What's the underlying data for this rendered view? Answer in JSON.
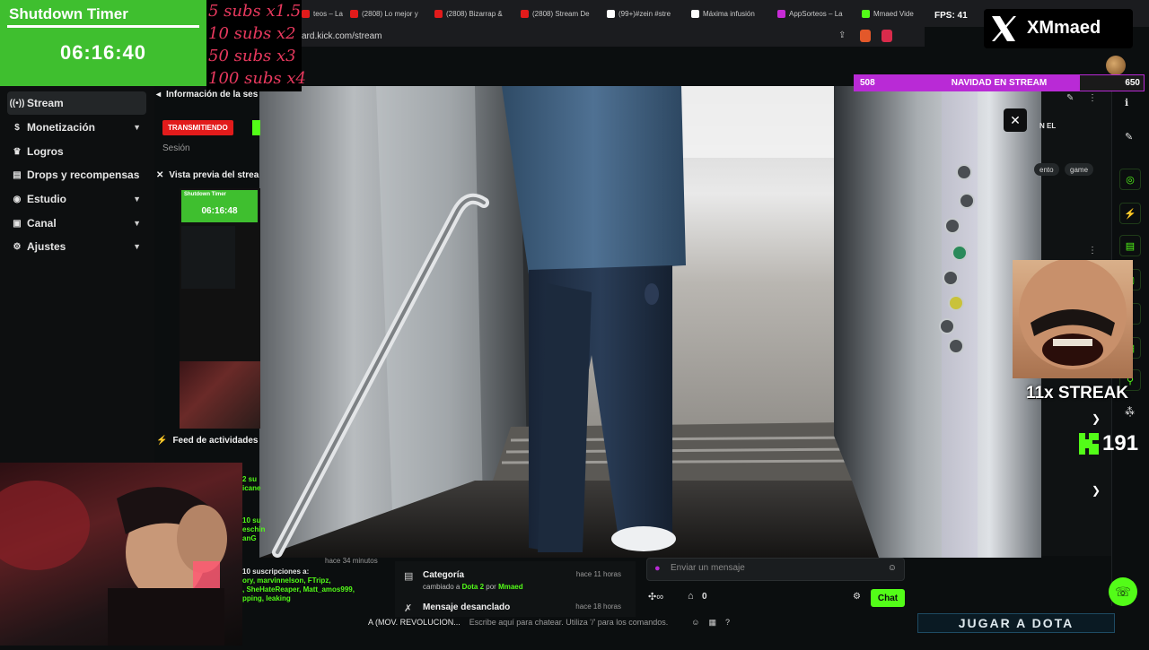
{
  "browser": {
    "tabs": [
      {
        "label": "teos – La",
        "color": "#e21b1b"
      },
      {
        "label": "(2808) Lo mejor y",
        "color": "#e21b1b"
      },
      {
        "label": "(2808) Bizarrap &",
        "color": "#e21b1b"
      },
      {
        "label": "(2808) Stream De",
        "color": "#e21b1b"
      },
      {
        "label": "(99+)#zein #stre",
        "color": "#ffffff"
      },
      {
        "label": "Máxima infusión",
        "color": "#ffffff"
      },
      {
        "label": "AppSorteos – La",
        "color": "#c72bd6"
      },
      {
        "label": "Mmaed Vide",
        "color": "#53fc18"
      }
    ],
    "url": "ard.kick.com/stream",
    "fps_label": "FPS: 41"
  },
  "timer": {
    "title": "Shutdown Timer",
    "value": "06:16:40"
  },
  "subs": [
    "5 subs x1.5",
    "10 subs x2",
    "50 subs x3",
    "100 subs x4"
  ],
  "sidebar": {
    "items": [
      {
        "label": "Stream",
        "icon": "broadcast-icon",
        "glyph": "((•))",
        "chevron": false,
        "active": true
      },
      {
        "label": "Monetización",
        "icon": "dollar-icon",
        "glyph": "$",
        "chevron": true,
        "active": false
      },
      {
        "label": "Logros",
        "icon": "trophy-icon",
        "glyph": "🏆",
        "chevron": false,
        "active": false
      },
      {
        "label": "Drops y recompensas",
        "icon": "gift-icon",
        "glyph": "🎁",
        "chevron": false,
        "active": false
      },
      {
        "label": "Estudio",
        "icon": "studio-icon",
        "glyph": "◉",
        "chevron": true,
        "active": false
      },
      {
        "label": "Canal",
        "icon": "channel-icon",
        "glyph": "▣",
        "chevron": true,
        "active": false
      },
      {
        "label": "Ajustes",
        "icon": "gear-icon",
        "glyph": "⚙",
        "chevron": true,
        "active": false
      }
    ]
  },
  "session": {
    "heading": "Información de la ses",
    "badge": "TRANSMITIENDO",
    "label": "Sesión"
  },
  "preview": {
    "heading": "Vista previa del strea",
    "timer_title": "Shutdown Timer",
    "timer_value": "06:16:48"
  },
  "feed": {
    "heading": "Feed de actividades",
    "lines": [
      "2 su",
      "icane",
      "10 su",
      "eschin",
      "anG"
    ],
    "time": "hace 34 minutos",
    "subs_line": "10 suscripciones a:",
    "names_1": "ory, marvinnelson, FTripz,",
    "names_2": ", SheHateReaper, Matt_amos999,",
    "names_3": "pping, leaking"
  },
  "activity": {
    "category_label": "Categoría",
    "category_time": "hace 11 horas",
    "category_desc_prefix": "cambiado a",
    "category_game": "Dota 2",
    "category_desc_mid": "por",
    "category_user": "Mmaed",
    "pinned_label": "Mensaje desanclado",
    "pinned_time": "hace 18 horas"
  },
  "chat": {
    "placeholder": "Enviar un mensaje",
    "count": "0",
    "button": "Chat",
    "bottom_user": "A (MOV. REVOLUCION...",
    "bottom_placeholder": "Escribe aquí para chatear. Utiliza '/' para los comandos."
  },
  "right": {
    "header_text": "N EL",
    "tags": [
      "ento",
      "game"
    ],
    "xname": "XMmaed",
    "navidad_left": "508",
    "navidad_title": "NAVIDAD EN STREAM",
    "navidad_right": "650",
    "navidad_progress": 0.78,
    "streak": "11x STREAK",
    "kick_count": "191",
    "jugar": "JUGAR A DOTA"
  },
  "colors": {
    "kick_green": "#53fc18",
    "timer_green": "#3fbf2f",
    "live_red": "#e21b1b",
    "purple": "#b92ad6"
  }
}
